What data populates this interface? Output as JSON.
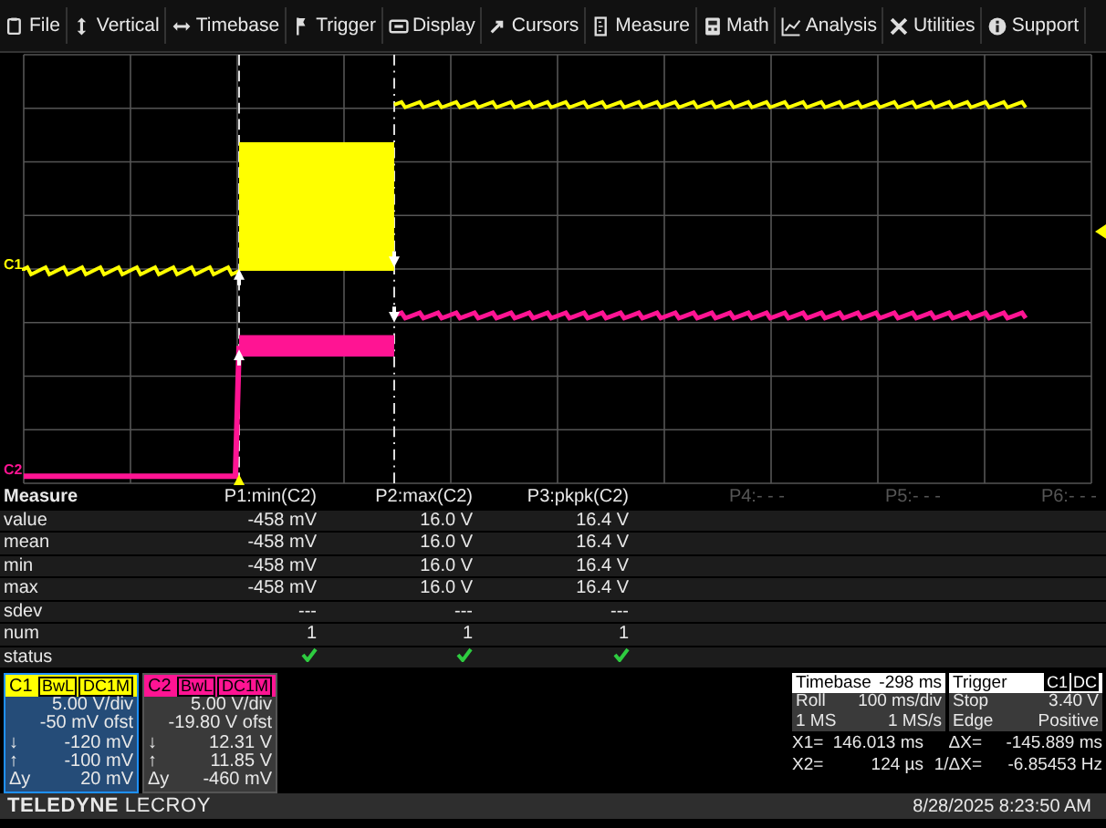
{
  "menu": [
    {
      "label": "File"
    },
    {
      "label": "Vertical"
    },
    {
      "label": "Timebase"
    },
    {
      "label": "Trigger"
    },
    {
      "label": "Display"
    },
    {
      "label": "Cursors"
    },
    {
      "label": "Measure"
    },
    {
      "label": "Math"
    },
    {
      "label": "Analysis"
    },
    {
      "label": "Utilities"
    },
    {
      "label": "Support"
    }
  ],
  "traces": [
    {
      "label": "C1",
      "color": "#ffff00"
    },
    {
      "label": "C2",
      "color": "#ff1493"
    }
  ],
  "measure": {
    "title": "Measure",
    "columns": [
      {
        "label": "P1:min(C2)",
        "active": true
      },
      {
        "label": "P2:max(C2)",
        "active": true
      },
      {
        "label": "P3:pkpk(C2)",
        "active": true
      },
      {
        "label": "P4:- - -",
        "active": false
      },
      {
        "label": "P5:- - -",
        "active": false
      },
      {
        "label": "P6:- - -",
        "active": false
      }
    ],
    "rows": [
      {
        "kind": "text",
        "label": "value",
        "cells": [
          "-458 mV",
          "16.0 V",
          "16.4 V"
        ]
      },
      {
        "kind": "text",
        "label": "mean",
        "cells": [
          "-458 mV",
          "16.0 V",
          "16.4 V"
        ]
      },
      {
        "kind": "text",
        "label": "min",
        "cells": [
          "-458 mV",
          "16.0 V",
          "16.4 V"
        ]
      },
      {
        "kind": "text",
        "label": "max",
        "cells": [
          "-458 mV",
          "16.0 V",
          "16.4 V"
        ]
      },
      {
        "kind": "text",
        "label": "sdev",
        "cells": [
          "---",
          "---",
          "---"
        ]
      },
      {
        "kind": "text",
        "label": "num",
        "cells": [
          "1",
          "1",
          "1"
        ]
      },
      {
        "kind": "status",
        "label": "status",
        "checks": [
          true,
          true,
          true
        ]
      }
    ]
  },
  "channels": [
    {
      "label": "C1",
      "color": "#ffff00",
      "selected": true,
      "tags": [
        "BwL",
        "DC1M"
      ],
      "rows": [
        {
          "symbol": "",
          "value": "5.00 V/div"
        },
        {
          "symbol": "",
          "value": "-50 mV ofst"
        },
        {
          "symbol": "↓",
          "value": "-120 mV"
        },
        {
          "symbol": "↑",
          "value": "-100 mV"
        },
        {
          "symbol": "Δy",
          "value": "20 mV"
        }
      ]
    },
    {
      "label": "C2",
      "color": "#ff1493",
      "selected": false,
      "tags": [
        "BwL",
        "DC1M"
      ],
      "rows": [
        {
          "symbol": "",
          "value": "5.00 V/div"
        },
        {
          "symbol": "",
          "value": "-19.80 V ofst"
        },
        {
          "symbol": "↓",
          "value": "12.31 V"
        },
        {
          "symbol": "↑",
          "value": "11.85 V"
        },
        {
          "symbol": "Δy",
          "value": "-460 mV"
        }
      ]
    }
  ],
  "timebase": {
    "title": "Timebase",
    "delay": "-298 ms",
    "rows": [
      [
        "Roll",
        "100 ms/div"
      ],
      [
        "1 MS",
        "1 MS/s"
      ]
    ]
  },
  "trigger": {
    "title": "Trigger",
    "tags": [
      "C1",
      "DC"
    ],
    "rows": [
      [
        "Stop",
        "3.40 V"
      ],
      [
        "Edge",
        "Positive"
      ]
    ]
  },
  "cursors": [
    [
      "X1=",
      "146.013 ms",
      "ΔX=",
      "-145.889 ms"
    ],
    [
      "X2=",
      "124 µs",
      "1/ΔX=",
      "-6.85453 Hz"
    ]
  ],
  "footer": {
    "brand": "**TELEDYNE** LECROY",
    "datetime": "8/28/2025 8:23:50 AM"
  }
}
